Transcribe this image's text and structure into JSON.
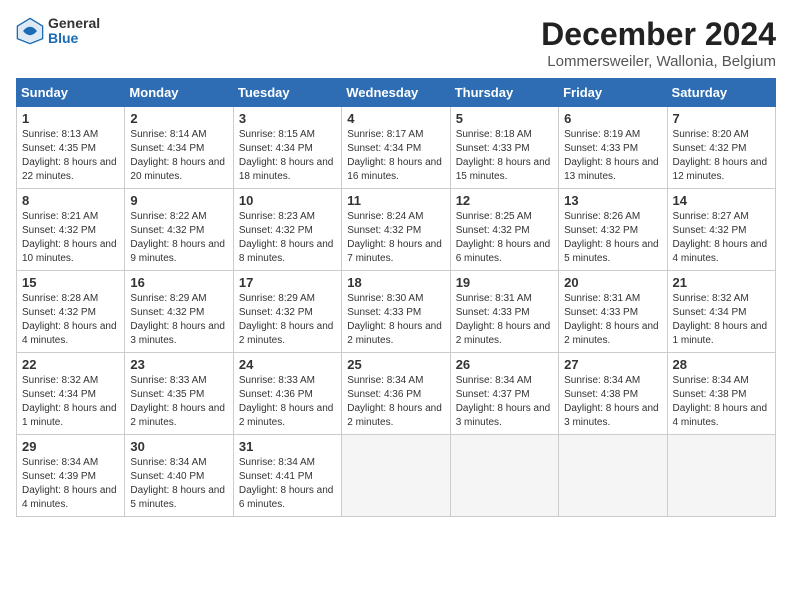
{
  "logo": {
    "general": "General",
    "blue": "Blue"
  },
  "title": "December 2024",
  "location": "Lommersweiler, Wallonia, Belgium",
  "days_of_week": [
    "Sunday",
    "Monday",
    "Tuesday",
    "Wednesday",
    "Thursday",
    "Friday",
    "Saturday"
  ],
  "weeks": [
    [
      {
        "day": "1",
        "sunrise": "Sunrise: 8:13 AM",
        "sunset": "Sunset: 4:35 PM",
        "daylight": "Daylight: 8 hours and 22 minutes."
      },
      {
        "day": "2",
        "sunrise": "Sunrise: 8:14 AM",
        "sunset": "Sunset: 4:34 PM",
        "daylight": "Daylight: 8 hours and 20 minutes."
      },
      {
        "day": "3",
        "sunrise": "Sunrise: 8:15 AM",
        "sunset": "Sunset: 4:34 PM",
        "daylight": "Daylight: 8 hours and 18 minutes."
      },
      {
        "day": "4",
        "sunrise": "Sunrise: 8:17 AM",
        "sunset": "Sunset: 4:34 PM",
        "daylight": "Daylight: 8 hours and 16 minutes."
      },
      {
        "day": "5",
        "sunrise": "Sunrise: 8:18 AM",
        "sunset": "Sunset: 4:33 PM",
        "daylight": "Daylight: 8 hours and 15 minutes."
      },
      {
        "day": "6",
        "sunrise": "Sunrise: 8:19 AM",
        "sunset": "Sunset: 4:33 PM",
        "daylight": "Daylight: 8 hours and 13 minutes."
      },
      {
        "day": "7",
        "sunrise": "Sunrise: 8:20 AM",
        "sunset": "Sunset: 4:32 PM",
        "daylight": "Daylight: 8 hours and 12 minutes."
      }
    ],
    [
      {
        "day": "8",
        "sunrise": "Sunrise: 8:21 AM",
        "sunset": "Sunset: 4:32 PM",
        "daylight": "Daylight: 8 hours and 10 minutes."
      },
      {
        "day": "9",
        "sunrise": "Sunrise: 8:22 AM",
        "sunset": "Sunset: 4:32 PM",
        "daylight": "Daylight: 8 hours and 9 minutes."
      },
      {
        "day": "10",
        "sunrise": "Sunrise: 8:23 AM",
        "sunset": "Sunset: 4:32 PM",
        "daylight": "Daylight: 8 hours and 8 minutes."
      },
      {
        "day": "11",
        "sunrise": "Sunrise: 8:24 AM",
        "sunset": "Sunset: 4:32 PM",
        "daylight": "Daylight: 8 hours and 7 minutes."
      },
      {
        "day": "12",
        "sunrise": "Sunrise: 8:25 AM",
        "sunset": "Sunset: 4:32 PM",
        "daylight": "Daylight: 8 hours and 6 minutes."
      },
      {
        "day": "13",
        "sunrise": "Sunrise: 8:26 AM",
        "sunset": "Sunset: 4:32 PM",
        "daylight": "Daylight: 8 hours and 5 minutes."
      },
      {
        "day": "14",
        "sunrise": "Sunrise: 8:27 AM",
        "sunset": "Sunset: 4:32 PM",
        "daylight": "Daylight: 8 hours and 4 minutes."
      }
    ],
    [
      {
        "day": "15",
        "sunrise": "Sunrise: 8:28 AM",
        "sunset": "Sunset: 4:32 PM",
        "daylight": "Daylight: 8 hours and 4 minutes."
      },
      {
        "day": "16",
        "sunrise": "Sunrise: 8:29 AM",
        "sunset": "Sunset: 4:32 PM",
        "daylight": "Daylight: 8 hours and 3 minutes."
      },
      {
        "day": "17",
        "sunrise": "Sunrise: 8:29 AM",
        "sunset": "Sunset: 4:32 PM",
        "daylight": "Daylight: 8 hours and 2 minutes."
      },
      {
        "day": "18",
        "sunrise": "Sunrise: 8:30 AM",
        "sunset": "Sunset: 4:33 PM",
        "daylight": "Daylight: 8 hours and 2 minutes."
      },
      {
        "day": "19",
        "sunrise": "Sunrise: 8:31 AM",
        "sunset": "Sunset: 4:33 PM",
        "daylight": "Daylight: 8 hours and 2 minutes."
      },
      {
        "day": "20",
        "sunrise": "Sunrise: 8:31 AM",
        "sunset": "Sunset: 4:33 PM",
        "daylight": "Daylight: 8 hours and 2 minutes."
      },
      {
        "day": "21",
        "sunrise": "Sunrise: 8:32 AM",
        "sunset": "Sunset: 4:34 PM",
        "daylight": "Daylight: 8 hours and 1 minute."
      }
    ],
    [
      {
        "day": "22",
        "sunrise": "Sunrise: 8:32 AM",
        "sunset": "Sunset: 4:34 PM",
        "daylight": "Daylight: 8 hours and 1 minute."
      },
      {
        "day": "23",
        "sunrise": "Sunrise: 8:33 AM",
        "sunset": "Sunset: 4:35 PM",
        "daylight": "Daylight: 8 hours and 2 minutes."
      },
      {
        "day": "24",
        "sunrise": "Sunrise: 8:33 AM",
        "sunset": "Sunset: 4:36 PM",
        "daylight": "Daylight: 8 hours and 2 minutes."
      },
      {
        "day": "25",
        "sunrise": "Sunrise: 8:34 AM",
        "sunset": "Sunset: 4:36 PM",
        "daylight": "Daylight: 8 hours and 2 minutes."
      },
      {
        "day": "26",
        "sunrise": "Sunrise: 8:34 AM",
        "sunset": "Sunset: 4:37 PM",
        "daylight": "Daylight: 8 hours and 3 minutes."
      },
      {
        "day": "27",
        "sunrise": "Sunrise: 8:34 AM",
        "sunset": "Sunset: 4:38 PM",
        "daylight": "Daylight: 8 hours and 3 minutes."
      },
      {
        "day": "28",
        "sunrise": "Sunrise: 8:34 AM",
        "sunset": "Sunset: 4:38 PM",
        "daylight": "Daylight: 8 hours and 4 minutes."
      }
    ],
    [
      {
        "day": "29",
        "sunrise": "Sunrise: 8:34 AM",
        "sunset": "Sunset: 4:39 PM",
        "daylight": "Daylight: 8 hours and 4 minutes."
      },
      {
        "day": "30",
        "sunrise": "Sunrise: 8:34 AM",
        "sunset": "Sunset: 4:40 PM",
        "daylight": "Daylight: 8 hours and 5 minutes."
      },
      {
        "day": "31",
        "sunrise": "Sunrise: 8:34 AM",
        "sunset": "Sunset: 4:41 PM",
        "daylight": "Daylight: 8 hours and 6 minutes."
      },
      null,
      null,
      null,
      null
    ]
  ]
}
